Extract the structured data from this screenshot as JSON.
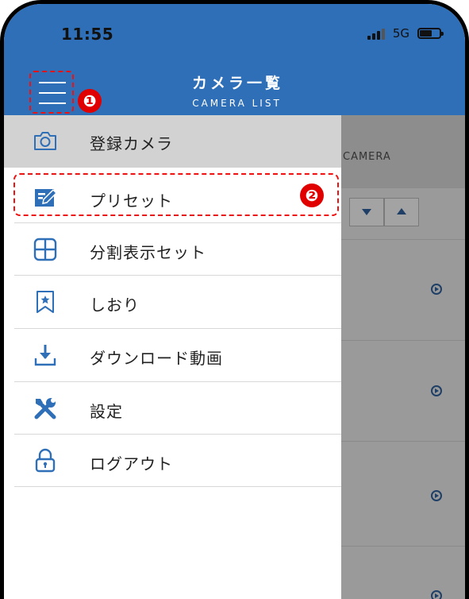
{
  "status_bar": {
    "time": "11:55",
    "network": "5G"
  },
  "header": {
    "title": "カメラ一覧",
    "subtitle": "CAMERA LIST"
  },
  "annotations": {
    "badge_1": "❶",
    "badge_2": "❷"
  },
  "background_list": {
    "column_label": "CAMERA"
  },
  "menu": {
    "items": [
      {
        "label": "登録カメラ",
        "icon": "camera-icon"
      },
      {
        "label": "プリセット",
        "icon": "preset-edit-icon"
      },
      {
        "label": "分割表示セット",
        "icon": "grid-split-icon"
      },
      {
        "label": "しおり",
        "icon": "bookmark-star-icon"
      },
      {
        "label": "ダウンロード動画",
        "icon": "download-icon"
      },
      {
        "label": "設定",
        "icon": "tools-icon"
      },
      {
        "label": "ログアウト",
        "icon": "lock-icon"
      }
    ]
  },
  "colors": {
    "header_blue": "#2f6fb7",
    "icon_blue": "#2f6fb7",
    "annotation_red": "#e10000",
    "selected_bg": "#d2d2d2"
  }
}
